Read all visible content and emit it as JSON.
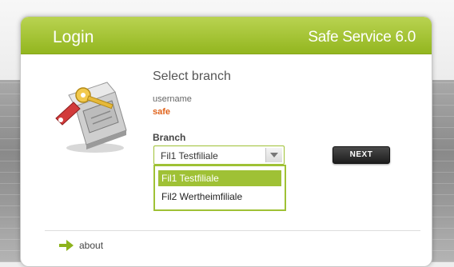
{
  "header": {
    "title": "Login",
    "app_title": "Safe Service 6.0"
  },
  "main": {
    "section_title": "Select branch",
    "username_label": "username",
    "username_value": "safe",
    "branch_label": "Branch",
    "branch_select": {
      "selected": "Fil1 Testfiliale",
      "options": [
        "Fil1 Testfiliale",
        "Fil2 Wertheimfiliale"
      ]
    },
    "next_label": "NEXT"
  },
  "footer": {
    "about_label": "about"
  },
  "colors": {
    "accent_green": "#9fc135",
    "username_orange": "#e0621a"
  },
  "icons": {
    "illustration": "safe-with-key-icon",
    "about": "arrow-right-icon",
    "dropdown": "chevron-down-icon"
  }
}
